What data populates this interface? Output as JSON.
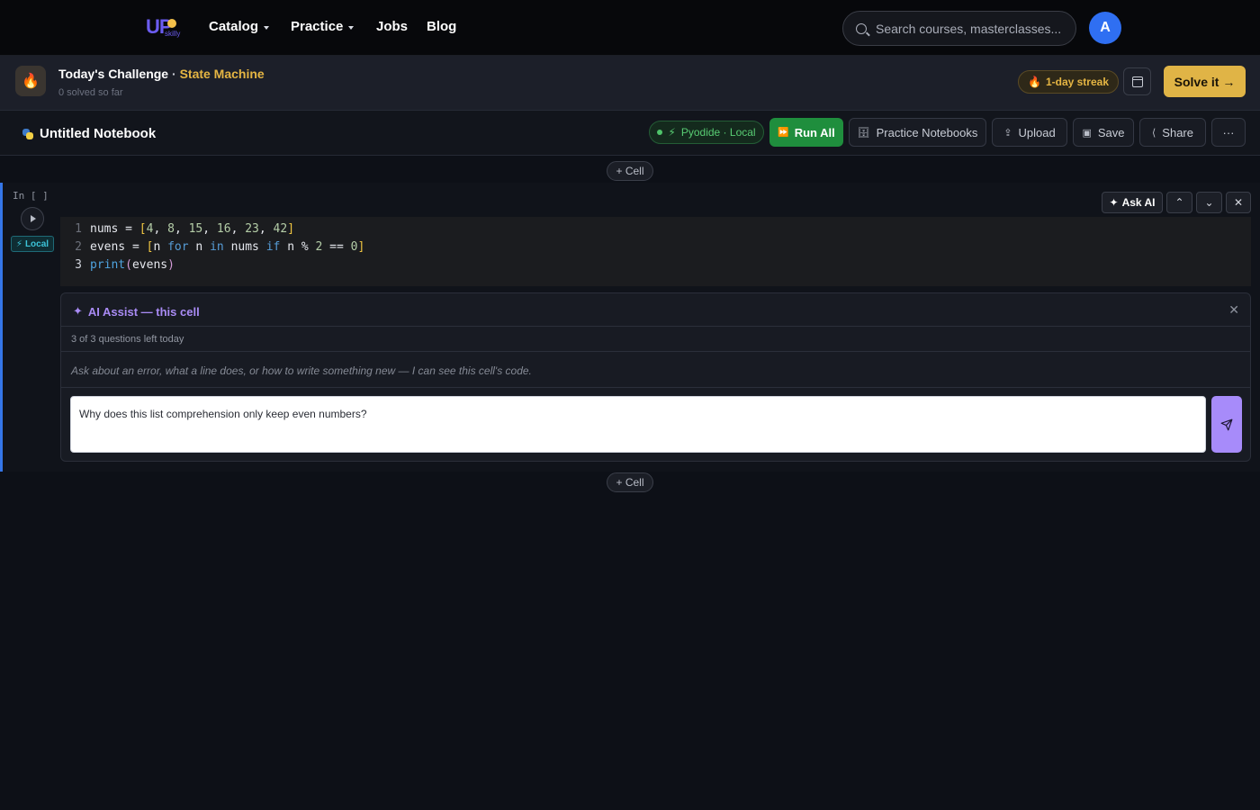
{
  "nav": {
    "logo_text": "UP",
    "logo_sub": "skilly",
    "links": [
      {
        "label": "Catalog",
        "has_caret": true
      },
      {
        "label": "Practice",
        "has_caret": true
      },
      {
        "label": "Jobs",
        "has_caret": false
      },
      {
        "label": "Blog",
        "has_caret": false
      }
    ],
    "search_placeholder": "Search courses, masterclasses...",
    "avatar_initial": "A",
    "colors": {
      "avatar": "#2f6ff2",
      "logo": "#6b5cf0"
    }
  },
  "challenge": {
    "icon": "fire-icon",
    "label": "Today's Challenge",
    "separator": "·",
    "name": "State Machine",
    "subtitle": "0 solved so far",
    "streak": "1-day streak",
    "solve_label": "Solve it →",
    "colors": {
      "accent": "#e0b446"
    }
  },
  "notebook": {
    "title": "Untitled Notebook",
    "runtime": "Pyodide · Local",
    "toolbar": {
      "run_all": "Run All",
      "practice": "Practice Notebooks",
      "upload": "Upload",
      "save": "Save",
      "share": "Share",
      "more": "···"
    },
    "add_cell_label": "+ Cell"
  },
  "cell": {
    "prompt": "In [ ]",
    "badge": "Local",
    "ask_ai": "Ask AI",
    "line_numbers": [
      "1",
      "2",
      "3"
    ],
    "code_lines": [
      "nums = [4, 8, 15, 16, 23, 42]",
      "evens = [n for n in nums if n % 2 == 0]",
      "print(evens)"
    ]
  },
  "ai_assist": {
    "title": "AI Assist — this cell",
    "quota": "3 of 3 questions left today",
    "hint": "Ask about an error, what a line does, or how to write something new — I can see this cell's code.",
    "input_value": "Why does this list comprehension only keep even numbers?",
    "colors": {
      "accent": "#a78bfa"
    }
  }
}
